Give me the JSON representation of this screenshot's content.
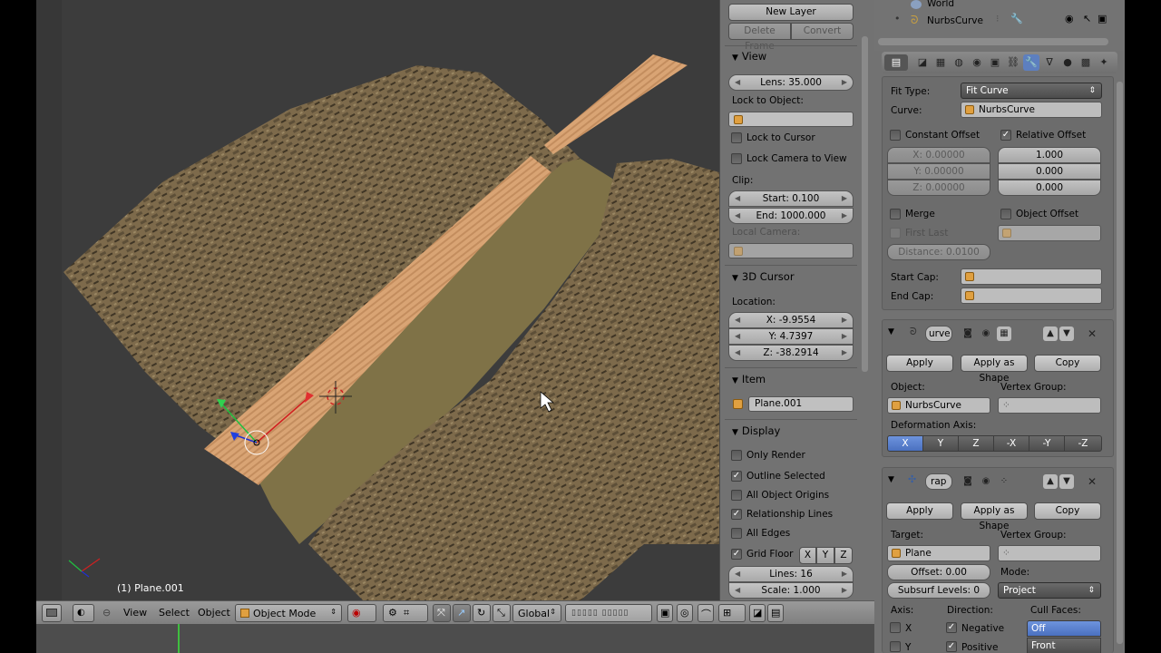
{
  "viewport": {
    "object_label": "(1) Plane.001"
  },
  "header": {
    "menu_view": "View",
    "menu_select": "Select",
    "menu_object": "Object",
    "mode": "Object Mode",
    "orientation": "Global"
  },
  "npanel": {
    "new_layer": "New Layer",
    "delete_frame": "Delete Frame",
    "convert": "Convert",
    "view_title": "View",
    "lens": "Lens: 35.000",
    "lock_to_object": "Lock to Object:",
    "lock_to_cursor": "Lock to Cursor",
    "lock_camera": "Lock Camera to View",
    "clip": "Clip:",
    "clip_start": "Start: 0.100",
    "clip_end": "End: 1000.000",
    "local_camera": "Local Camera:",
    "cursor_title": "3D Cursor",
    "location": "Location:",
    "loc_x": "X: -9.9554",
    "loc_y": "Y: 4.7397",
    "loc_z": "Z: -38.2914",
    "item_title": "Item",
    "item_name": "Plane.001",
    "display_title": "Display",
    "only_render": "Only Render",
    "outline_selected": "Outline Selected",
    "all_object_origins": "All Object Origins",
    "relationship_lines": "Relationship Lines",
    "all_edges": "All Edges",
    "grid_floor": "Grid Floor",
    "grid_x": "X",
    "grid_y": "Y",
    "grid_z": "Z",
    "lines": "Lines: 16",
    "scale": "Scale: 1.000"
  },
  "outliner": {
    "world": "World",
    "nurbs_curve": "NurbsCurve"
  },
  "array": {
    "fit_type_label": "Fit Type:",
    "fit_type_value": "Fit Curve",
    "curve_label": "Curve:",
    "curve_value": "NurbsCurve",
    "constant_offset": "Constant Offset",
    "relative_offset": "Relative Offset",
    "const_x": "X: 0.00000",
    "const_y": "Y: 0.00000",
    "const_z": "Z: 0.00000",
    "rel_x": "1.000",
    "rel_y": "0.000",
    "rel_z": "0.000",
    "merge": "Merge",
    "object_offset": "Object Offset",
    "first_last": "First Last",
    "distance": "Distance: 0.0100",
    "start_cap": "Start Cap:",
    "end_cap": "End Cap:"
  },
  "curve_mod": {
    "name": "urve",
    "apply": "Apply",
    "apply_as_shape": "Apply as Shape",
    "copy": "Copy",
    "object_label": "Object:",
    "object_value": "NurbsCurve",
    "vertex_group": "Vertex Group:",
    "deform_axis": "Deformation Axis:",
    "axes": [
      "X",
      "Y",
      "Z",
      "-X",
      "-Y",
      "-Z"
    ]
  },
  "shrinkwrap": {
    "name": "rap",
    "apply": "Apply",
    "apply_as_shape": "Apply as Shape",
    "copy": "Copy",
    "target_label": "Target:",
    "target_value": "Plane",
    "vertex_group": "Vertex Group:",
    "offset": "Offset: 0.00",
    "mode_label": "Mode:",
    "subsurf": "Subsurf Levels: 0",
    "mode_value": "Project",
    "axis_label": "Axis:",
    "direction_label": "Direction:",
    "cull_label": "Cull Faces:",
    "axis_x": "X",
    "axis_y": "Y",
    "negative": "Negative",
    "positive": "Positive",
    "cull_off": "Off",
    "cull_front": "Front"
  },
  "colors": {
    "accent_blue": "#5d7fbf",
    "panel_gray": "#727272",
    "viewport_bg": "#3c3c3c"
  }
}
